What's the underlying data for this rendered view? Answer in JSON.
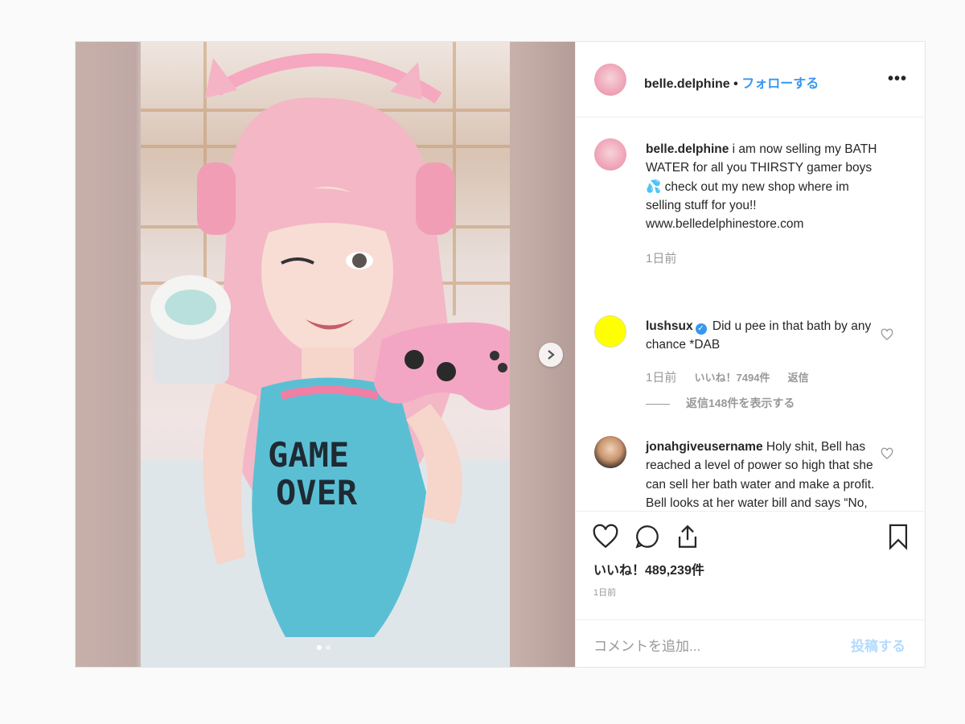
{
  "post": {
    "username": "belle.delphine",
    "separator": "•",
    "follow_label": "フォローする",
    "more_label": "•••"
  },
  "caption": {
    "username": "belle.delphine",
    "text": "i am now selling my BATH WATER for all you THIRSTY gamer boys 💦 check out my new shop where im selling stuff for you!! www.belledelphinestore.com",
    "time": "1日前"
  },
  "comments": [
    {
      "username": "lushsux",
      "verified": true,
      "text": "Did u pee in that bath by any chance *DAB",
      "time": "1日前",
      "likes": "いいね！7494件",
      "reply_label": "返信",
      "view_replies": "返信148件を表示する",
      "avatar_color": "#ffff00"
    },
    {
      "username": "jonahgiveusername",
      "verified": false,
      "text": "Holy shit, Bell has reached a level of power so high that she can sell her bath water and make a profit. Bell looks at her water bill and says “No, you pay me”"
    }
  ],
  "actions": {
    "likes_count": "いいね！489,239件",
    "timestamp": "1日前"
  },
  "comment_input": {
    "placeholder": "コメントを追加...",
    "post_label": "投稿する"
  },
  "carousel": {
    "slide_count": 2,
    "active_slide": 1
  },
  "colors": {
    "link": "#3897f0",
    "post_disabled": "#b3dbff",
    "muted": "#999999"
  },
  "icons": [
    "heart-icon",
    "comment-icon",
    "share-icon",
    "bookmark-icon",
    "chevron-right-icon",
    "more-icon",
    "verified-icon"
  ]
}
